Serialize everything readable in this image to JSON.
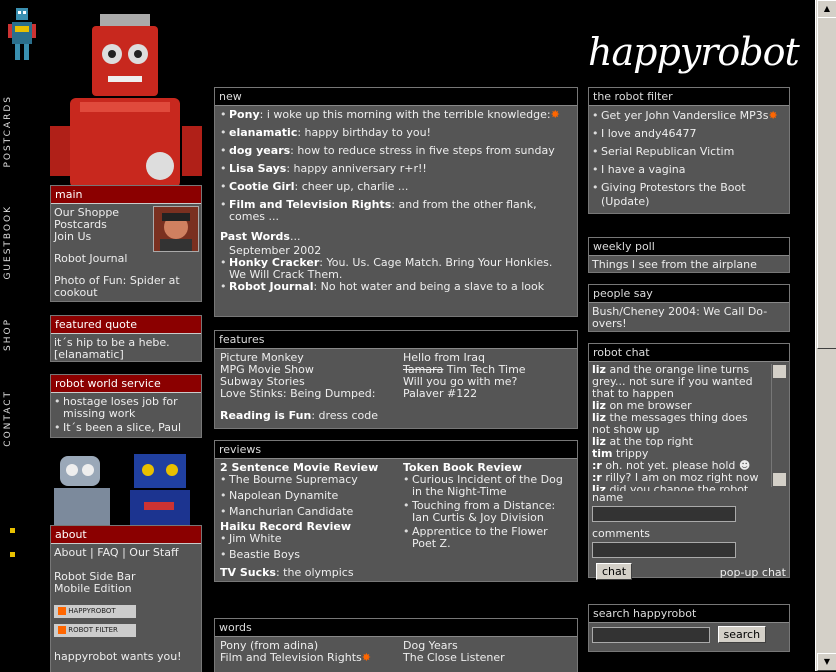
{
  "site": {
    "name": "happyrobot"
  },
  "sidebar_nav": [
    {
      "label": "POSTCARDS"
    },
    {
      "label": "GUESTBOOK"
    },
    {
      "label": "SHOP"
    },
    {
      "label": "CONTACT"
    }
  ],
  "main_box": {
    "title": "main",
    "links": [
      "Our Shoppe",
      "Postcards",
      "Join Us"
    ],
    "robot_journal": "Robot Journal",
    "photo_of_fun": "Photo of Fun: Spider at cookout"
  },
  "featured_quote": {
    "title": "featured quote",
    "text": "it´s hip to be a hebe. [elanamatic]"
  },
  "robot_world_service": {
    "title": "robot world service",
    "items": [
      "hostage loses job for missing work",
      "It´s been a slice, Paul"
    ]
  },
  "about": {
    "title": "about",
    "links": [
      "About",
      "FAQ",
      "Our Staff"
    ],
    "sep": "|",
    "robot_side_bar": "Robot Side Bar",
    "mobile_edition": "Mobile Edition",
    "badge1": "HAPPYROBOT",
    "badge2": "ROBOT FILTER",
    "wants_you": "happyrobot wants you!"
  },
  "new": {
    "title": "new",
    "items": [
      {
        "who": "Pony",
        "text": ": i woke up this morning with the terrible knowledge:",
        "star": "✸"
      },
      {
        "who": "elanamatic",
        "text": ": happy birthday to you!"
      },
      {
        "who": "dog years",
        "text": ": how to reduce stress in five steps from sunday"
      },
      {
        "who": "Lisa Says",
        "text": ": happy anniversary r+r!!"
      },
      {
        "who": "Cootie Girl",
        "text": ": cheer up, charlie ..."
      },
      {
        "who": "Film and Television Rights",
        "text": ": and from the other flank, comes ..."
      }
    ],
    "past_words": "Past Words",
    "past_words_suffix": "...",
    "past_date": "September 2002",
    "past_items": [
      {
        "who": "Honky Cracker",
        "text": ": You. Us. Cage Match. Bring Your Honkies. We Will Crack Them."
      },
      {
        "who": "Robot Journal",
        "text": ": No hot water and being a slave to a look"
      }
    ]
  },
  "features": {
    "title": "features",
    "left": [
      "Picture Monkey",
      "MPG Movie Show",
      "Subway Stories",
      "Love Stinks: Being Dumped:"
    ],
    "right_1": "Hello from Iraq",
    "right_2_strike": "Tamara",
    "right_2": " Tim Tech Time",
    "right_3": "Will you go with me?",
    "right_4": "Palaver #122",
    "reading_label": "Reading is Fun",
    "reading_text": ": dress code"
  },
  "reviews": {
    "title": "reviews",
    "sentence_title": "2 Sentence Movie Review",
    "sentence_items": [
      "The Bourne Supremacy",
      "Napolean Dynamite",
      "Manchurian Candidate"
    ],
    "haiku_title": "Haiku Record Review",
    "haiku_items": [
      "Jim White",
      "Beastie Boys"
    ],
    "tv_label": "TV Sucks",
    "tv_text": ": the olympics",
    "token_title": "Token Book Review",
    "token_items": [
      "Curious Incident of the Dog in the Night-Time",
      "Touching from a Distance: Ian Curtis & Joy Division",
      "Apprentice to the Flower Poet Z."
    ]
  },
  "words": {
    "title": "words",
    "left": [
      "Pony (from adina)",
      "Film and Television Rights"
    ],
    "right": [
      "Dog Years",
      "The Close Listener"
    ],
    "star": "✸"
  },
  "robot_filter": {
    "title": "the robot filter",
    "items": [
      {
        "text": "Get yer John Vanderslice MP3s",
        "star": "✸"
      },
      {
        "text": "I love andy46477"
      },
      {
        "text": "Serial Republican Victim"
      },
      {
        "text": "I have a vagina"
      },
      {
        "text": "Giving Protestors the Boot (Update)"
      }
    ]
  },
  "weekly_poll": {
    "title": "weekly poll",
    "text": "Things I see from the airplane"
  },
  "people_say": {
    "title": "people say",
    "text": "Bush/Cheney 2004: We Call Do-overs!"
  },
  "robot_chat": {
    "title": "robot chat",
    "messages": [
      {
        "who": "liz",
        "text": " and the orange line turns grey... not sure if you wanted that to happen"
      },
      {
        "who": "liz",
        "text": " on me browser"
      },
      {
        "who": "liz",
        "text": " the messages thing does not show up"
      },
      {
        "who": "liz",
        "text": " at the top right"
      },
      {
        "who": "tim",
        "text": " trippy"
      },
      {
        "who": ":r",
        "text": " oh. not yet. please hold ☻"
      },
      {
        "who": ":r",
        "text": " rilly? I am on moz right now"
      },
      {
        "who": "liz",
        "text": " did you change the robot"
      }
    ],
    "name_label": "name",
    "comments_label": "comments",
    "chat_button": "chat",
    "popup": "pop-up chat"
  },
  "search": {
    "title": "search happyrobot",
    "button": "search"
  },
  "colors": {
    "red_header": "#8b0000",
    "box_bg": "#555555",
    "star": "#ff6600"
  }
}
